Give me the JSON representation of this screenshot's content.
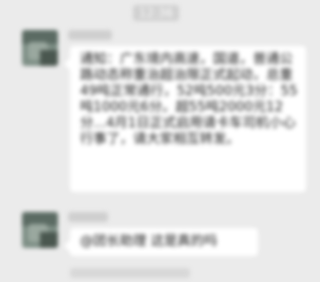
{
  "status_bar": {
    "time": "12:36"
  },
  "messages": [
    {
      "text": "通知：广东境内高速，国道，普通公路动态称重治超治限正式起动，总重49吨正常通行，52吨500元3分：55吨1000元6分。超55吨2000元12分...4月1日正式启用请卡车司机小心行事了，请大家相互转发。"
    },
    {
      "text": "@团长助理 这是真的吗"
    }
  ]
}
